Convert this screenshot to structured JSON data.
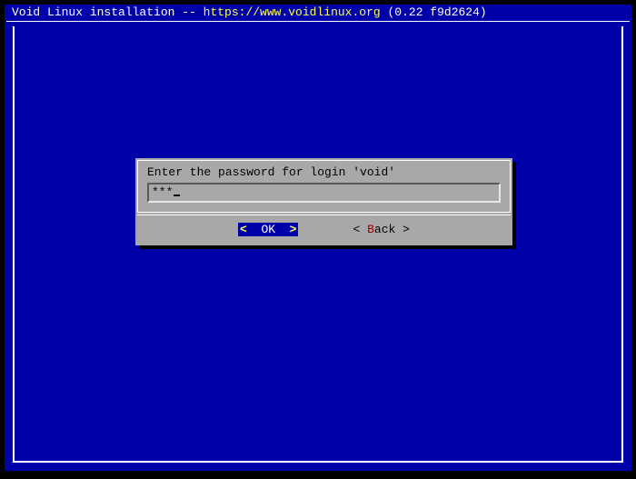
{
  "title": {
    "prefix": "Void Linux installation -- ",
    "url": "https://www.voidlinux.org",
    "suffix": " (0.22 f9d2624)"
  },
  "dialog": {
    "prompt": "Enter the password for login 'void'",
    "input_masked": "***"
  },
  "buttons": {
    "ok": {
      "label": "OK",
      "left_angle": "<",
      "right_angle": ">",
      "selected": true
    },
    "back": {
      "hotkey": "B",
      "rest": "ack",
      "left_angle": "<",
      "right_angle": ">"
    }
  }
}
